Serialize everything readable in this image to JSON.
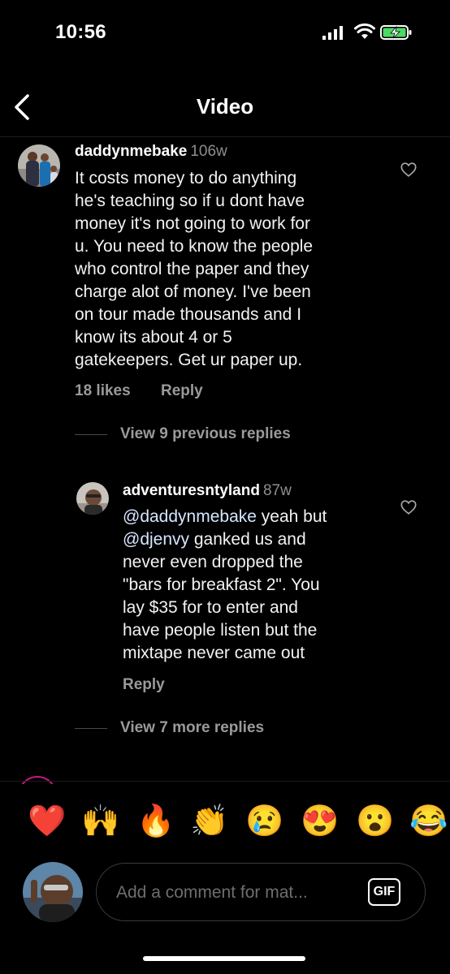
{
  "status_bar": {
    "time": "10:56"
  },
  "header": {
    "title": "Video"
  },
  "comments": [
    {
      "username": "daddynmebake",
      "age": "106w",
      "lines": [
        "It costs money to do anything",
        "he's teaching so if u dont have",
        "money it's not going to work for",
        "u. You need to know the people",
        "who control the paper and they",
        "charge alot of money. I've been",
        "on tour made thousands and I",
        "know its about 4 or 5",
        "gatekeepers. Get ur paper up."
      ],
      "likes": "18 likes",
      "reply": "Reply"
    }
  ],
  "view_previous": "View 9 previous replies",
  "reply_comment": {
    "username": "adventuresntyland",
    "age": "87w",
    "mention1": "@daddynmebake",
    "line1_rest": " yeah but",
    "mention2": "@djenvy",
    "line2_rest": " ganked us and",
    "lines": [
      "never even dropped the",
      "\"bars for breakfast 2\". You",
      "lay $35 for to enter and",
      "have people listen but the",
      "mixtape never came out"
    ],
    "reply": "Reply"
  },
  "view_more": "View 7 more replies",
  "emojis": [
    "❤️",
    "🙌",
    "🔥",
    "👏",
    "😢",
    "😍",
    "😮",
    "😂"
  ],
  "composer": {
    "placeholder": "Add a comment for mat...",
    "gif": "GIF"
  },
  "colors": {
    "background": "#000000",
    "muted": "#9a9a9a",
    "mention": "#d6e6ff"
  }
}
